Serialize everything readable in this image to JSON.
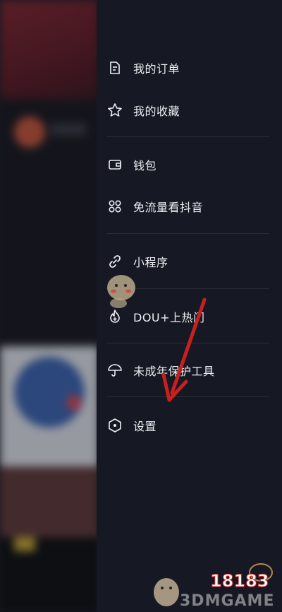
{
  "menu": {
    "items": [
      {
        "label": "我的订单",
        "icon": "order-icon"
      },
      {
        "label": "我的收藏",
        "icon": "star-icon"
      },
      {
        "label": "钱包",
        "icon": "wallet-icon"
      },
      {
        "label": "免流量看抖音",
        "icon": "grid-icon"
      },
      {
        "label": "小程序",
        "icon": "link-icon"
      },
      {
        "label": "DOU+上热门",
        "icon": "flame-icon"
      },
      {
        "label": "未成年保护工具",
        "icon": "umbrella-icon"
      },
      {
        "label": "设置",
        "icon": "hexagon-icon"
      }
    ]
  },
  "watermark": {
    "number": "18183",
    "brand": "3DMGAME"
  },
  "colors": {
    "drawer_bg": "#161823",
    "text": "#eceef3",
    "divider": "#2a2d38",
    "annotation_arrow": "#c8201f"
  }
}
